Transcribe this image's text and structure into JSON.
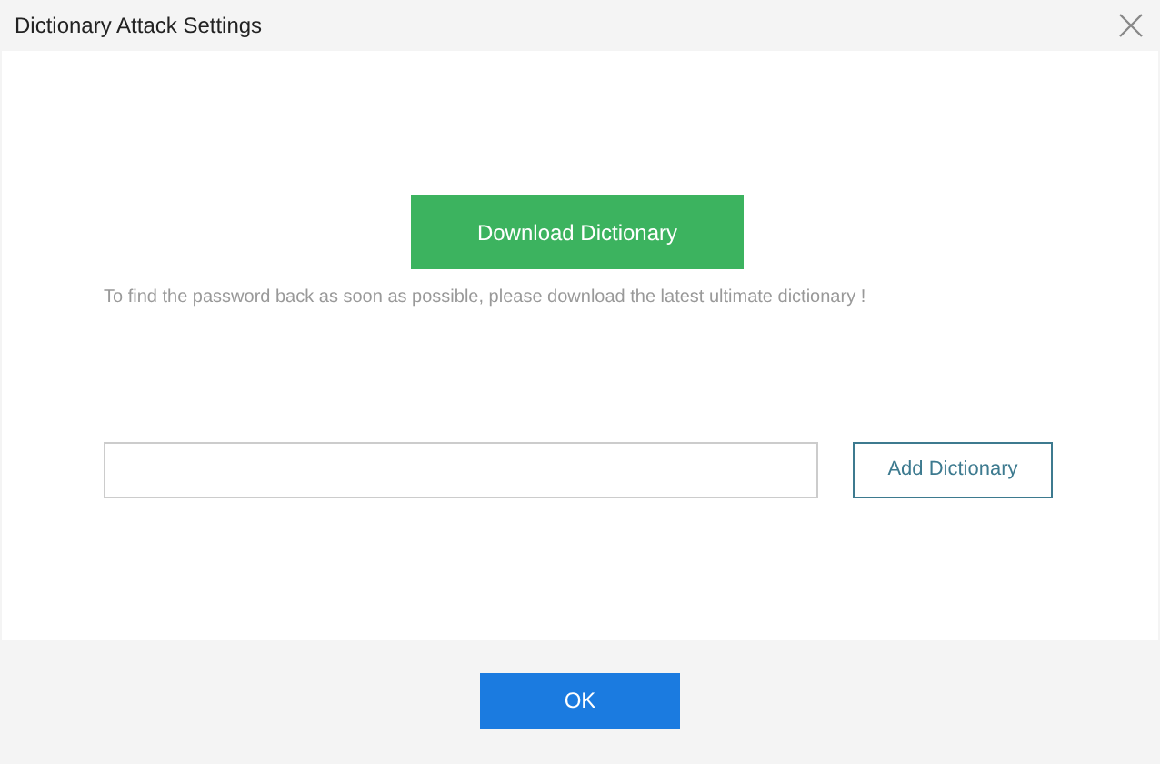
{
  "window": {
    "title": "Dictionary Attack Settings"
  },
  "download_button": "Download Dictionary",
  "hint": "To find the password back as soon as possible, please download the latest ultimate dictionary !",
  "add_button": "Add Dictionary",
  "ok_button": "OK"
}
